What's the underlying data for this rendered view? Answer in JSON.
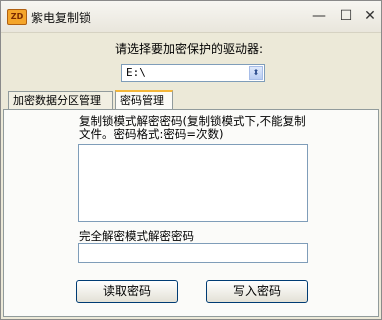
{
  "window": {
    "title": "紫电复制锁",
    "app_icon_text": "ZD",
    "controls": {
      "minimize": "—",
      "maximize": "☐",
      "close": "✕"
    }
  },
  "drive": {
    "label": "请选择要加密保护的驱动器:",
    "selected": "E:\\",
    "arrow": "⬍"
  },
  "tabs": [
    {
      "label": "加密数据分区管理",
      "active": false
    },
    {
      "label": "密码管理",
      "active": true
    }
  ],
  "password_panel": {
    "copylock_label": "复制锁模式解密密码(复制锁模式下,不能复制文件。密码格式:密码=次数)",
    "copylock_value": "",
    "full_label": "完全解密模式解密密码",
    "full_value": ""
  },
  "buttons": {
    "read": "读取密码",
    "write": "写入密码"
  },
  "colors": {
    "window_bg": "#ECE9D8",
    "panel_bg": "#FBFBF9",
    "active_tab_accent": "#F4B73A",
    "border": "#7F9DB9"
  }
}
